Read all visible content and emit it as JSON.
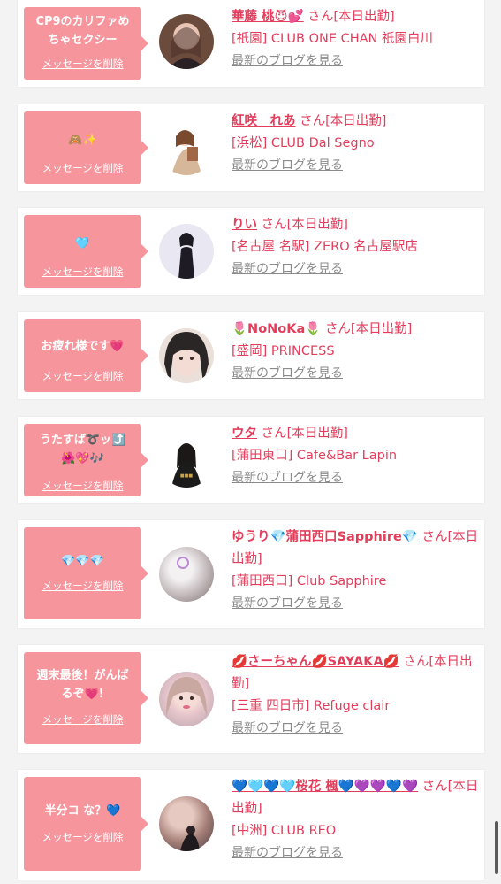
{
  "delete_label": "メッセージを削除",
  "blog_label": "最新のブログを見る",
  "colors": {
    "accent": "#e23e5c",
    "bubble": "#f7959d",
    "link_gray": "#8a8a8a"
  },
  "cards": [
    {
      "message": "CP9のカリファめ\nちゃセクシー",
      "name": "華藤 桃😈💕",
      "suffix": "さん[本日出勤]",
      "shop": "[祇園] CLUB ONE CHAN 祇園白川"
    },
    {
      "message": "🙈✨",
      "name": "紅咲　れあ",
      "suffix": "さん[本日出勤]",
      "shop": "[浜松] CLUB Dal Segno"
    },
    {
      "message": "🩵",
      "name": "りい",
      "suffix": "さん[本日出勤]",
      "shop": "[名古屋 名駅] ZERO 名古屋駅店"
    },
    {
      "message": "お疲れ様です💗",
      "name": "🌷NoNoKa🌷",
      "suffix": "さん[本日出勤]",
      "shop": "[盛岡] PRINCESS"
    },
    {
      "message": "うたすば➰ッ⤴️\n🌺💖🎶",
      "name": "ウタ",
      "suffix": "さん[本日出勤]",
      "shop": "[蒲田東口] Cafe&Bar Lapin"
    },
    {
      "message": "💎💎💎",
      "name": "ゆうり💎蒲田西口Sapphire💎",
      "suffix": "さん[本日出勤]",
      "shop": "[蒲田西口] Club Sapphire"
    },
    {
      "message": "週末最後！がんば\nるぞ💗!",
      "name": "💋さーちゃん💋SAYAKA💋",
      "suffix": "さん[本日出勤]",
      "shop": "[三重 四日市] Refuge clair"
    },
    {
      "message": "半分コ な？💙",
      "name": "💙🩵💙🩵桜花 楓💙💜💜💙💜",
      "suffix": "さん[本日出勤]",
      "shop": "[中洲] CLUB REO"
    }
  ]
}
